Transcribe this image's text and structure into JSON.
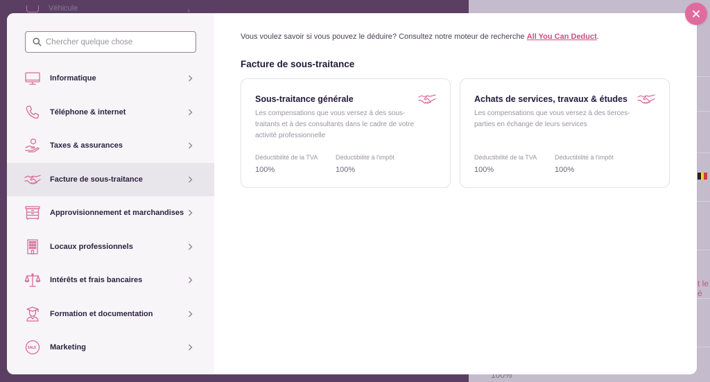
{
  "background": {
    "top_item_label": "Véhicule",
    "right_fragment": "t le é",
    "bottom_value": "100%"
  },
  "search": {
    "placeholder": "Chercher quelque chose",
    "value": ""
  },
  "sidebar": {
    "items": [
      {
        "label": "Informatique",
        "icon": "computer-monitor-icon",
        "active": false
      },
      {
        "label": "Téléphone & internet",
        "icon": "phone-icon",
        "active": false
      },
      {
        "label": "Taxes & assurances",
        "icon": "hand-coins-icon",
        "active": false
      },
      {
        "label": "Facture de sous-traitance",
        "icon": "handshake-icon",
        "active": true
      },
      {
        "label": "Approvisionnement et marchandises",
        "icon": "cabinet-icon",
        "active": false
      },
      {
        "label": "Locaux professionnels",
        "icon": "building-icon",
        "active": false
      },
      {
        "label": "Intérêts et frais bancaires",
        "icon": "scales-icon",
        "active": false
      },
      {
        "label": "Formation et documentation",
        "icon": "graduate-icon",
        "active": false
      },
      {
        "label": "Marketing",
        "icon": "sale-badge-icon",
        "active": false
      }
    ]
  },
  "main": {
    "intro_text": "Vous voulez savoir si vous pouvez le déduire? Consultez notre moteur de recherche ",
    "intro_link": "All You Can Deduct",
    "intro_end": ".",
    "section_title": "Facture de sous-traitance",
    "cards": [
      {
        "title": "Sous-traitance générale",
        "description": "Les compensations que vous versez à des sous-traitants et à des consultants dans le cadre de votre activité professionnelle",
        "icon": "handshake-icon",
        "vat_label": "Déductibilité de la TVA",
        "vat_value": "100%",
        "tax_label": "Déductibilité à l'impôt",
        "tax_value": "100%"
      },
      {
        "title": "Achats de services, travaux & études",
        "description": "Les compensations que vous versez à des tierces-parties en échange de leurs services",
        "icon": "handshake-icon",
        "vat_label": "Déductibilité de la TVA",
        "vat_value": "100%",
        "tax_label": "Déductibilité à l'impôt",
        "tax_value": "100%"
      }
    ]
  },
  "colors": {
    "accent": "#e06b9f",
    "link": "#d1497f",
    "icon_stroke": "#d96b98",
    "active_bg": "#e9e6eb"
  },
  "close_icon": "close-icon"
}
